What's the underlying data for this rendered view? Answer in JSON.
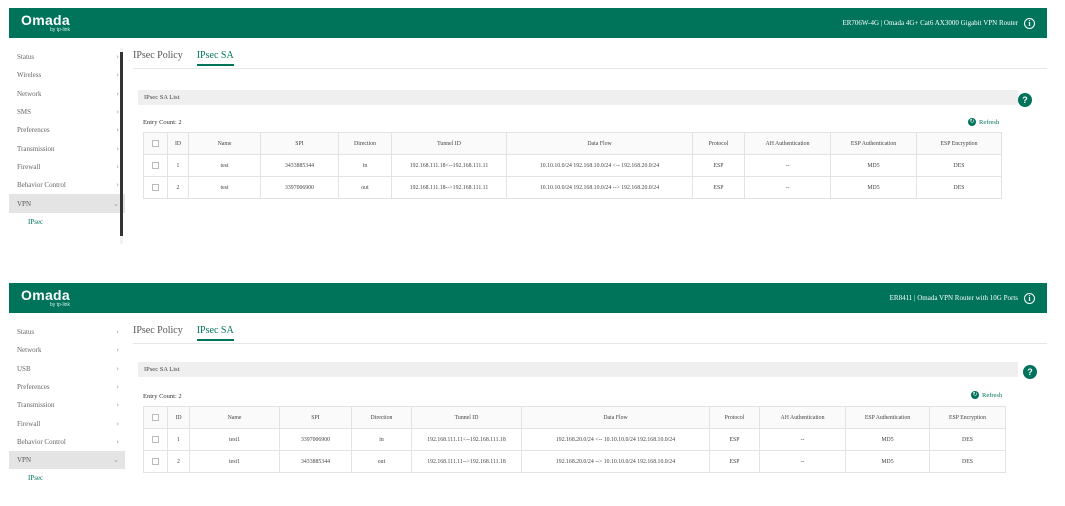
{
  "colors": {
    "brand": "#00735b",
    "section_bg": "#efefef",
    "active_nav_bg": "#e4e4e4"
  },
  "panels": [
    {
      "logo": "Omada",
      "logo_sub": "by tp-link",
      "device_title": "ER706W-4G | Omada 4G+ Cat6 AX3000 Gigabit VPN Router",
      "info_icon": "info-circle-icon",
      "sidebar": {
        "items": [
          {
            "label": "Status",
            "icon": "chevron-right-icon"
          },
          {
            "label": "Wireless",
            "icon": "chevron-right-icon"
          },
          {
            "label": "Network",
            "icon": "chevron-right-icon"
          },
          {
            "label": "SMS",
            "icon": "chevron-right-icon"
          },
          {
            "label": "Preferences",
            "icon": "chevron-right-icon"
          },
          {
            "label": "Transmission",
            "icon": "chevron-right-icon"
          },
          {
            "label": "Firewall",
            "icon": "chevron-right-icon"
          },
          {
            "label": "Behavior Control",
            "icon": "chevron-right-icon"
          },
          {
            "label": "VPN",
            "icon": "chevron-down-icon"
          }
        ],
        "subitem": "IPsec"
      },
      "tabs": [
        "IPsec Policy",
        "IPsec SA"
      ],
      "section_title": "IPsec SA List",
      "entry_count": "Entry Count: 2",
      "refresh_label": "Refresh",
      "columns": [
        "ID",
        "Name",
        "SPI",
        "Direction",
        "Tunnel ID",
        "Data Flow",
        "Protocol",
        "AH Authentication",
        "ESP Authentication",
        "ESP Encryption"
      ],
      "rows": [
        [
          "1",
          "test",
          "3433885344",
          "in",
          "192.168.111.18<--192.168.111.11",
          "10.10.10.0/24 192.168.10.0/24 <-- 192.168.20.0/24",
          "ESP",
          "--",
          "MD5",
          "DES"
        ],
        [
          "2",
          "test",
          "3397006900",
          "out",
          "192.168.111.18-->192.168.111.11",
          "10.10.10.0/24 192.168.10.0/24 --> 192.168.20.0/24",
          "ESP",
          "--",
          "MD5",
          "DES"
        ]
      ]
    },
    {
      "logo": "Omada",
      "logo_sub": "by tp-link",
      "device_title": "ER8411 | Omada VPN Router with 10G Ports",
      "info_icon": "info-circle-icon",
      "sidebar": {
        "items": [
          {
            "label": "Status",
            "icon": "chevron-right-icon"
          },
          {
            "label": "Network",
            "icon": "chevron-right-icon"
          },
          {
            "label": "USB",
            "icon": "chevron-right-icon"
          },
          {
            "label": "Preferences",
            "icon": "chevron-right-icon"
          },
          {
            "label": "Transmission",
            "icon": "chevron-right-icon"
          },
          {
            "label": "Firewall",
            "icon": "chevron-right-icon"
          },
          {
            "label": "Behavior Control",
            "icon": "chevron-right-icon"
          },
          {
            "label": "VPN",
            "icon": "chevron-down-icon"
          }
        ],
        "subitem": "IPsec"
      },
      "tabs": [
        "IPsec Policy",
        "IPsec SA"
      ],
      "section_title": "IPsec SA List",
      "entry_count": "Entry Count: 2",
      "refresh_label": "Refresh",
      "columns": [
        "ID",
        "Name",
        "SPI",
        "Direction",
        "Tunnel ID",
        "Data Flow",
        "Protocol",
        "AH Authentication",
        "ESP Authentication",
        "ESP Encryption"
      ],
      "rows": [
        [
          "1",
          "test1",
          "3397006900",
          "in",
          "192.168.111.11<--192.168.111.18",
          "192.168.20.0/24 <-- 10.10.10.0/24 192.168.10.0/24",
          "ESP",
          "--",
          "MD5",
          "DES"
        ],
        [
          "2",
          "test1",
          "3433885344",
          "out",
          "192.168.111.11-->192.168.111.18",
          "192.168.20.0/24 --> 10.10.10.0/24 192.168.10.0/24",
          "ESP",
          "--",
          "MD5",
          "DES"
        ]
      ]
    }
  ]
}
